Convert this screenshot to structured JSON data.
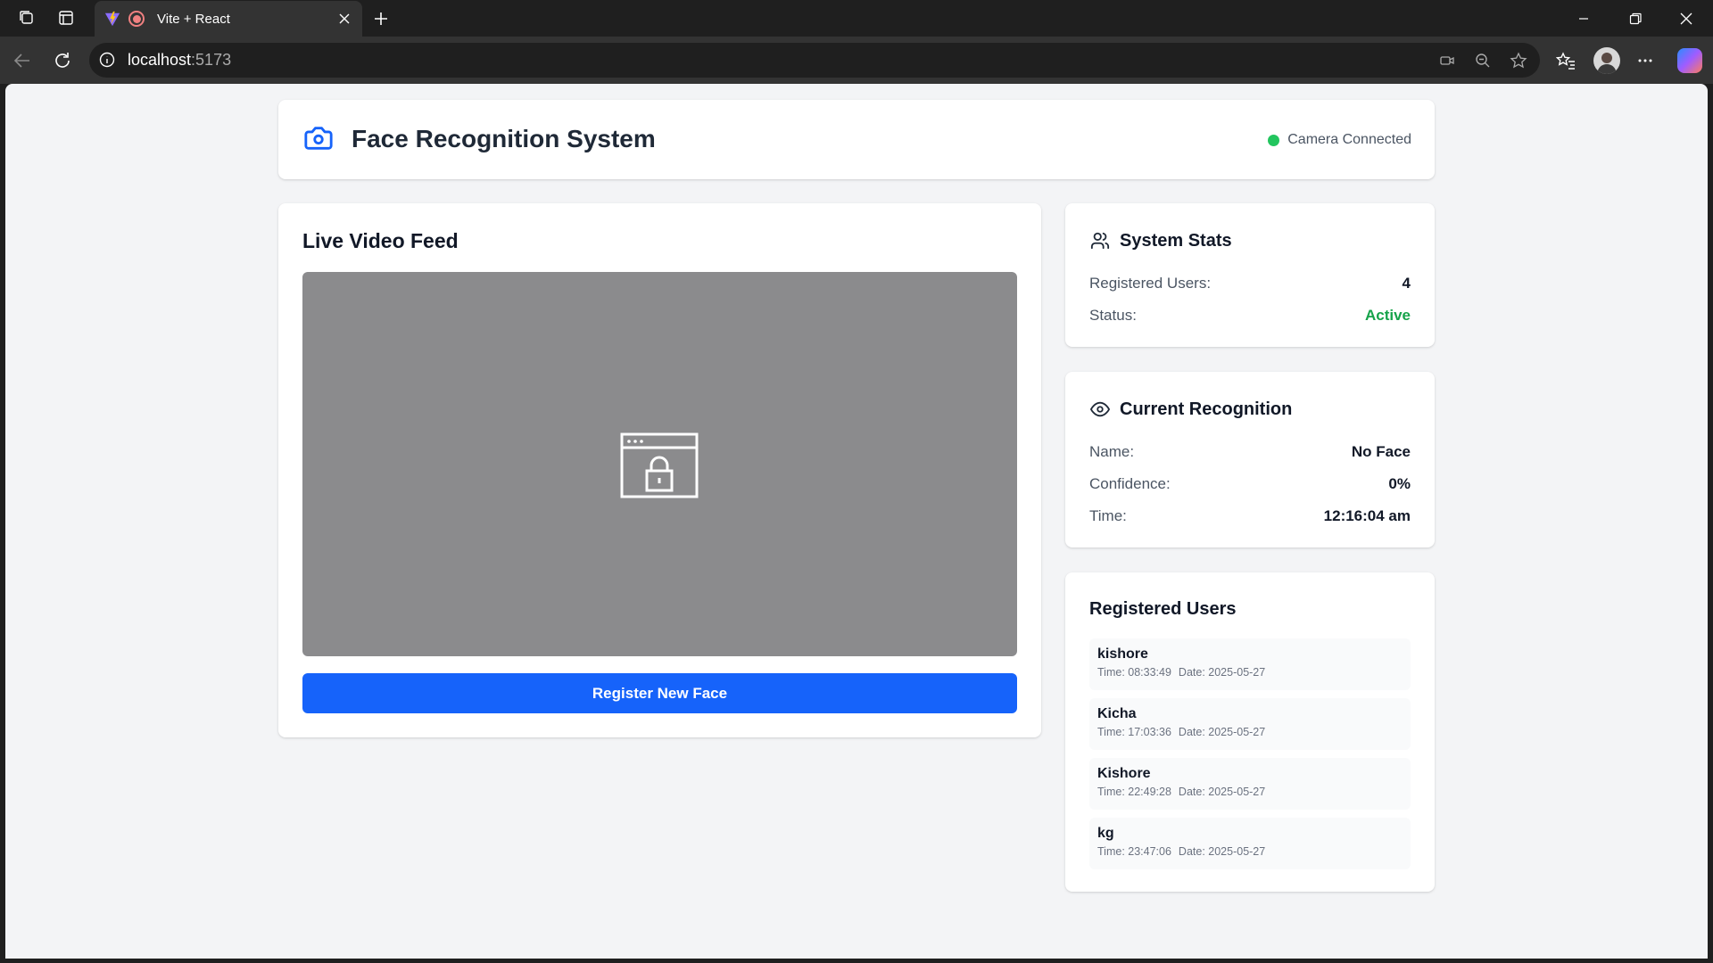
{
  "browser": {
    "tab_title": "Vite + React",
    "url_host": "localhost",
    "url_port": ":5173"
  },
  "header": {
    "title": "Face Recognition System",
    "camera_status": "Camera Connected",
    "camera_status_color": "#22c55e"
  },
  "video": {
    "title": "Live Video Feed",
    "register_button": "Register New Face"
  },
  "stats": {
    "title": "System Stats",
    "registered_users_label": "Registered Users:",
    "registered_users_value": "4",
    "status_label": "Status:",
    "status_value": "Active"
  },
  "recognition": {
    "title": "Current Recognition",
    "name_label": "Name:",
    "name_value": "No Face",
    "confidence_label": "Confidence:",
    "confidence_value": "0%",
    "time_label": "Time:",
    "time_value": "12:16:04 am"
  },
  "users": {
    "title": "Registered Users",
    "items": [
      {
        "name": "kishore",
        "time": "Time: 08:33:49",
        "date": "Date: 2025-05-27"
      },
      {
        "name": "Kicha",
        "time": "Time: 17:03:36",
        "date": "Date: 2025-05-27"
      },
      {
        "name": "Kishore",
        "time": "Time: 22:49:28",
        "date": "Date: 2025-05-27"
      },
      {
        "name": "kg",
        "time": "Time: 23:47:06",
        "date": "Date: 2025-05-27"
      }
    ]
  },
  "colors": {
    "accent": "#1663fa",
    "active": "#16a34a"
  }
}
